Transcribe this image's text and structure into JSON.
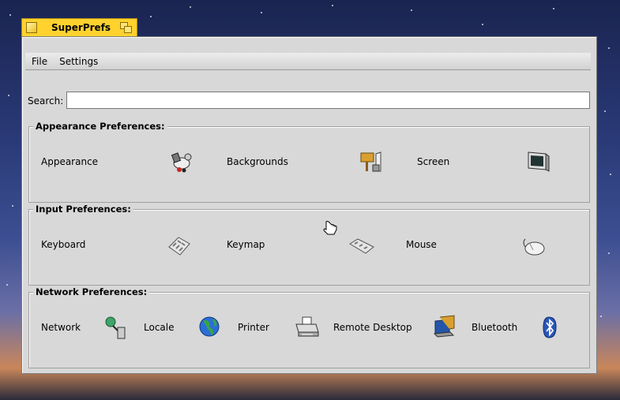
{
  "window": {
    "title": "SuperPrefs"
  },
  "menu": {
    "file": "File",
    "settings": "Settings"
  },
  "search": {
    "label": "Search:",
    "value": "",
    "placeholder": ""
  },
  "groups": {
    "appearance": {
      "title": "Appearance Preferences:",
      "items": [
        {
          "label": "Appearance",
          "icon": "appearance-icon"
        },
        {
          "label": "Backgrounds",
          "icon": "backgrounds-icon"
        },
        {
          "label": "Screen",
          "icon": "screen-icon"
        }
      ]
    },
    "input": {
      "title": "Input Preferences:",
      "items": [
        {
          "label": "Keyboard",
          "icon": "keyboard-icon"
        },
        {
          "label": "Keymap",
          "icon": "keymap-icon"
        },
        {
          "label": "Mouse",
          "icon": "mouse-icon"
        }
      ]
    },
    "network": {
      "title": "Network Preferences:",
      "items": [
        {
          "label": "Network",
          "icon": "network-icon"
        },
        {
          "label": "Locale",
          "icon": "globe-icon"
        },
        {
          "label": "Printer",
          "icon": "printer-icon"
        },
        {
          "label": "Remote Desktop",
          "icon": "remote-desktop-icon"
        },
        {
          "label": "Bluetooth",
          "icon": "bluetooth-icon"
        }
      ]
    }
  },
  "colors": {
    "tab": "#ffd22e",
    "window_bg": "#d8d8d8"
  }
}
